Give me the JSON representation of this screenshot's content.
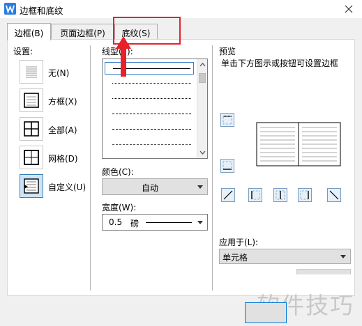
{
  "window": {
    "title": "边框和底纹"
  },
  "tabs": [
    {
      "label": "边框(B)",
      "active": true
    },
    {
      "label": "页面边框(P)",
      "active": false
    },
    {
      "label": "底纹(S)",
      "active": false
    }
  ],
  "settings": {
    "label": "设置:",
    "items": [
      {
        "label": "无(N)",
        "icon": "border-none-icon",
        "selected": false
      },
      {
        "label": "方框(X)",
        "icon": "border-box-icon",
        "selected": false
      },
      {
        "label": "全部(A)",
        "icon": "border-all-icon",
        "selected": false
      },
      {
        "label": "网格(D)",
        "icon": "border-grid-icon",
        "selected": false
      },
      {
        "label": "自定义(U)",
        "icon": "border-custom-icon",
        "selected": true
      }
    ]
  },
  "line_style": {
    "label": "线型(Y):"
  },
  "color": {
    "label": "颜色(C):",
    "value": "自动"
  },
  "width": {
    "label": "宽度(W):",
    "value": "0.5",
    "unit": "磅"
  },
  "preview": {
    "label": "预览",
    "hint": "单击下方图示或按钮可设置边框"
  },
  "apply_to": {
    "label": "应用于(L):",
    "value": "单元格"
  },
  "watermark": "软件技巧",
  "colors": {
    "accent": "#2b7de1",
    "highlight": "#e8202a",
    "selected_bg": "#cce4f7"
  }
}
